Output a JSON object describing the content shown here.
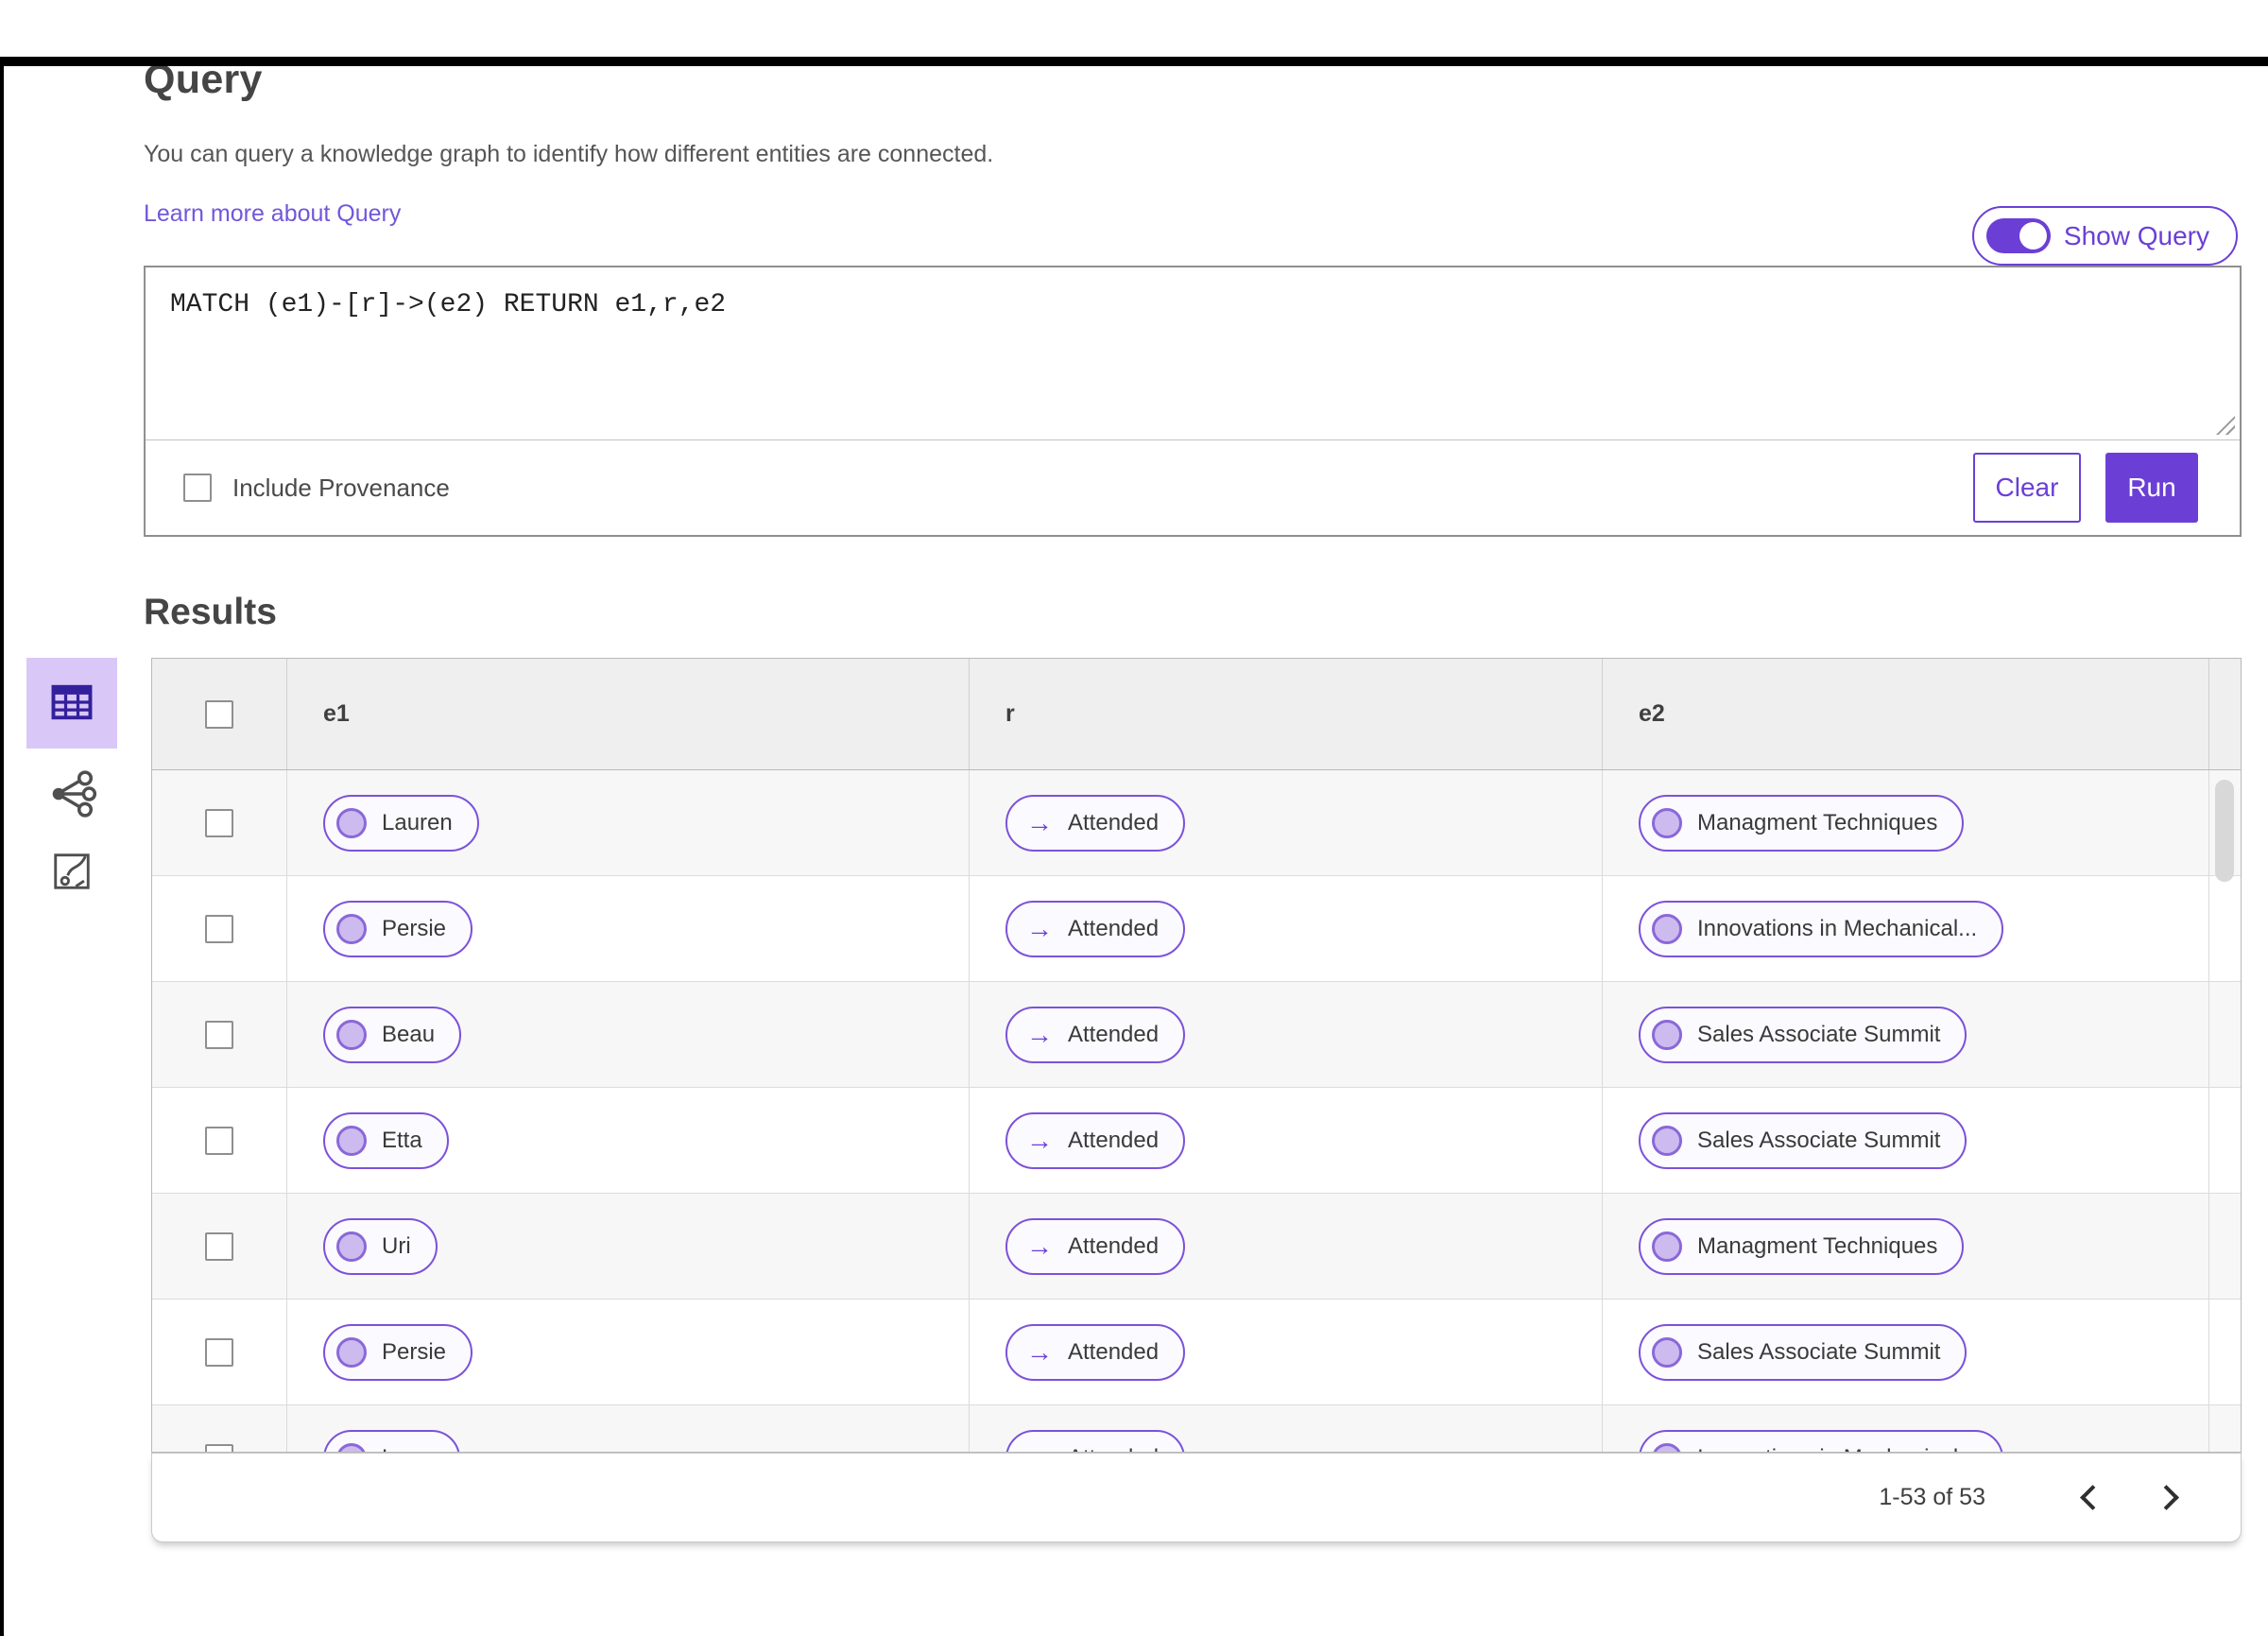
{
  "query_section": {
    "title": "Query",
    "description": "You can query a knowledge graph to identify how different entities are connected.",
    "learn_more_link": "Learn more about Query",
    "show_query_toggle": {
      "label": "Show Query",
      "state": "on"
    },
    "query_input": {
      "value": "MATCH (e1)-[r]->(e2) RETURN e1,r,e2"
    },
    "include_provenance": {
      "label": "Include Provenance",
      "checked": false
    },
    "buttons": {
      "clear": "Clear",
      "run": "Run"
    }
  },
  "results_section": {
    "title": "Results",
    "view_rail": [
      {
        "name": "table-view",
        "icon": "table-icon",
        "active": true
      },
      {
        "name": "network-view",
        "icon": "network-graph-icon",
        "active": false
      },
      {
        "name": "map-view",
        "icon": "freeform-chart-icon",
        "active": false
      }
    ],
    "table": {
      "columns": [
        "e1",
        "r",
        "e2"
      ],
      "arrow_glyph": "→",
      "rows": [
        {
          "e1": "Lauren",
          "r": "Attended",
          "e2": "Managment Techniques"
        },
        {
          "e1": "Persie",
          "r": "Attended",
          "e2": "Innovations in Mechanical..."
        },
        {
          "e1": "Beau",
          "r": "Attended",
          "e2": "Sales Associate Summit"
        },
        {
          "e1": "Etta",
          "r": "Attended",
          "e2": "Sales Associate Summit"
        },
        {
          "e1": "Uri",
          "r": "Attended",
          "e2": "Managment Techniques"
        },
        {
          "e1": "Persie",
          "r": "Attended",
          "e2": "Sales Associate Summit"
        },
        {
          "e1": "Larry",
          "r": "Attended",
          "e2": "Innovations in Mechanical..."
        }
      ]
    },
    "pagination": {
      "range_text": "1-53 of 53"
    }
  },
  "colors": {
    "accent_purple": "#6b3fd6",
    "chip_border": "#7c52d9",
    "chip_circle_fill": "#cdbbf0",
    "active_view_bg": "#d9c8f7",
    "link_purple": "#7257da",
    "header_gray": "#efefef",
    "zebra_gray": "#f7f7f7"
  }
}
